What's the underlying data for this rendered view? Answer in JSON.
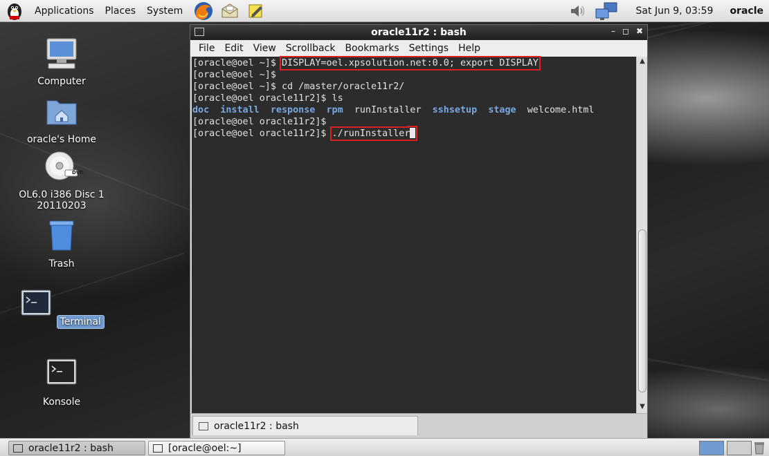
{
  "top_panel": {
    "menus": [
      "Applications",
      "Places",
      "System"
    ],
    "clock": "Sat Jun  9, 03:59",
    "user": "oracle"
  },
  "desktop_icons": [
    {
      "label": "Computer"
    },
    {
      "label": "oracle's Home"
    },
    {
      "label_line1": "OL6.0 i386 Disc 1",
      "label_line2": "20110203",
      "badge": "DVD"
    },
    {
      "label": "Trash"
    },
    {
      "label": "Terminal"
    },
    {
      "label": "Konsole"
    }
  ],
  "window": {
    "title": "oracle11r2 : bash",
    "menu": [
      "File",
      "Edit",
      "View",
      "Scrollback",
      "Bookmarks",
      "Settings",
      "Help"
    ],
    "tab_label": "oracle11r2 : bash"
  },
  "terminal": {
    "line1_prompt": "[oracle@oel ~]$ ",
    "line1_cmd": "DISPLAY=oel.xpsolution.net:0.0; export DISPLAY",
    "line2": "[oracle@oel ~]$",
    "line3": "[oracle@oel ~]$ cd /master/oracle11r2/",
    "line4": "[oracle@oel oracle11r2]$ ls",
    "ls_dirs": [
      "doc",
      "install",
      "response",
      "rpm",
      "sshsetup",
      "stage"
    ],
    "ls_files": [
      "runInstaller",
      "welcome.html"
    ],
    "line6": "[oracle@oel oracle11r2]$",
    "line7_prompt": "[oracle@oel oracle11r2]$ ",
    "line7_cmd": "./runInstaller"
  },
  "taskbar": {
    "tasks": [
      "oracle11r2 : bash",
      "[oracle@oel:~]"
    ]
  },
  "colors": {
    "highlight": "#e02020",
    "directory": "#79a7e0",
    "terminal_bg": "#2c2c2c"
  }
}
